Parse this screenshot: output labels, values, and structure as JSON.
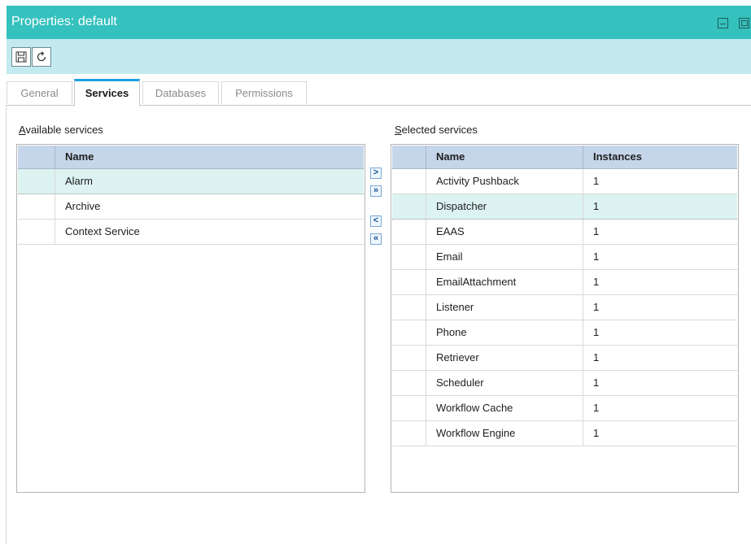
{
  "window": {
    "title": "Properties: default"
  },
  "toolbar": {
    "save_icon": "save-icon",
    "refresh_icon": "refresh-icon"
  },
  "tabs": [
    {
      "label": "General",
      "active": false
    },
    {
      "label": "Services",
      "active": true
    },
    {
      "label": "Databases",
      "active": false
    },
    {
      "label": "Permissions",
      "active": false
    }
  ],
  "available": {
    "label": "Available services",
    "columns": [
      "Name"
    ],
    "rows": [
      {
        "name": "Alarm",
        "selected": true
      },
      {
        "name": "Archive",
        "selected": false
      },
      {
        "name": "Context Service",
        "selected": false
      }
    ]
  },
  "mover": {
    "add": ">",
    "add_all": "»",
    "remove": "<",
    "remove_all": "«"
  },
  "selected": {
    "label": "Selected services",
    "columns": [
      "Name",
      "Instances"
    ],
    "rows": [
      {
        "name": "Activity Pushback",
        "instances": "1",
        "selected": false
      },
      {
        "name": "Dispatcher",
        "instances": "1",
        "selected": true
      },
      {
        "name": "EAAS",
        "instances": "1",
        "selected": false
      },
      {
        "name": "Email",
        "instances": "1",
        "selected": false
      },
      {
        "name": "EmailAttachment",
        "instances": "1",
        "selected": false
      },
      {
        "name": "Listener",
        "instances": "1",
        "selected": false
      },
      {
        "name": "Phone",
        "instances": "1",
        "selected": false
      },
      {
        "name": "Retriever",
        "instances": "1",
        "selected": false
      },
      {
        "name": "Scheduler",
        "instances": "1",
        "selected": false
      },
      {
        "name": "Workflow Cache",
        "instances": "1",
        "selected": false
      },
      {
        "name": "Workflow Engine",
        "instances": "1",
        "selected": false
      }
    ]
  }
}
